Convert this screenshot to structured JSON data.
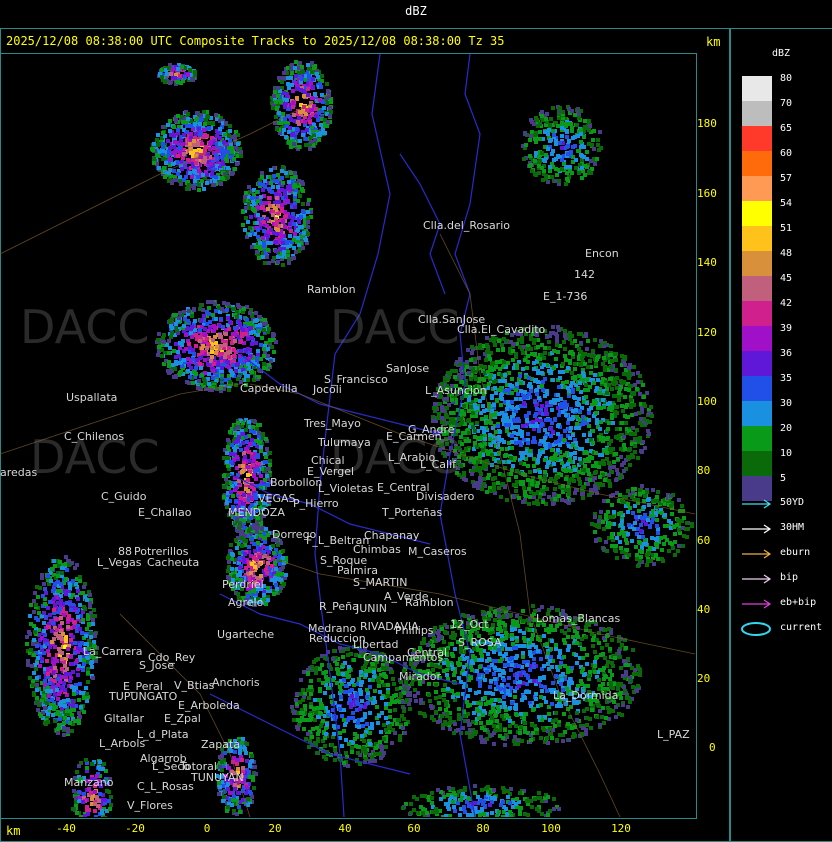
{
  "window_title": "dBZ",
  "header": {
    "text": "2025/12/08 08:38:00 UTC Composite Tracks to 2025/12/08 08:38:00 Tz 35",
    "km_unit": "km"
  },
  "axes": {
    "x_ticks": [
      "-40",
      "-20",
      "0",
      "20",
      "40",
      "60",
      "80",
      "100",
      "120"
    ],
    "y_ticks": [
      "180",
      "160",
      "140",
      "120",
      "100",
      "80",
      "60",
      "40",
      "20",
      "0"
    ],
    "x_unit": "km"
  },
  "legend": {
    "title": "dBZ",
    "levels": [
      {
        "label": "80",
        "color": "#e8e8e8"
      },
      {
        "label": "70",
        "color": "#bdbdbd"
      },
      {
        "label": "65",
        "color": "#ff3a2a"
      },
      {
        "label": "60",
        "color": "#ff6a0a"
      },
      {
        "label": "57",
        "color": "#ff9a55"
      },
      {
        "label": "54",
        "color": "#ffff00"
      },
      {
        "label": "51",
        "color": "#ffc21a"
      },
      {
        "label": "48",
        "color": "#d8913a"
      },
      {
        "label": "45",
        "color": "#c0607c"
      },
      {
        "label": "42",
        "color": "#d0208e"
      },
      {
        "label": "39",
        "color": "#a010c8"
      },
      {
        "label": "36",
        "color": "#6018d8"
      },
      {
        "label": "35",
        "color": "#2050e8"
      },
      {
        "label": "30",
        "color": "#1a90e0"
      },
      {
        "label": "20",
        "color": "#0a9a1a"
      },
      {
        "label": "10",
        "color": "#0a6a0a"
      },
      {
        "label": "5",
        "color": "#4a3a8a"
      }
    ],
    "tracks": [
      {
        "label": "50YD",
        "color": "#40e0f0"
      },
      {
        "label": "30HM",
        "color": "#ffffff"
      },
      {
        "label": "eburn",
        "color": "#f0b040"
      },
      {
        "label": "bip",
        "color": "#f0d0f0"
      },
      {
        "label": "eb+bip",
        "color": "#e040e0"
      },
      {
        "label": "current",
        "color": "#30d8f0"
      }
    ]
  },
  "places": [
    {
      "name": "Clla.del_Rosario"
    },
    {
      "name": "Encon"
    },
    {
      "name": "142"
    },
    {
      "name": "E_1-736"
    },
    {
      "name": "Ramblon"
    },
    {
      "name": "Clla.SanJose"
    },
    {
      "name": "Clla.El_Cavadito"
    },
    {
      "name": "Uspallata"
    },
    {
      "name": "C_Chilenos"
    },
    {
      "name": "aredas"
    },
    {
      "name": "Capdevilla"
    },
    {
      "name": "S_Francisco"
    },
    {
      "name": "Jocoli"
    },
    {
      "name": "SanJose"
    },
    {
      "name": "L_Asuncion"
    },
    {
      "name": "Tres_Mayo"
    },
    {
      "name": "Tulumaya"
    },
    {
      "name": "E_Carmen"
    },
    {
      "name": "G_Andre"
    },
    {
      "name": "Chical"
    },
    {
      "name": "L_Arabio"
    },
    {
      "name": "E_Vergel"
    },
    {
      "name": "L_Calif"
    },
    {
      "name": "Borbollon"
    },
    {
      "name": "L_Violetas"
    },
    {
      "name": "E_Central"
    },
    {
      "name": "Divisadero"
    },
    {
      "name": "C_Guido"
    },
    {
      "name": "VEGAS"
    },
    {
      "name": "P_Hierro"
    },
    {
      "name": "E_Challao"
    },
    {
      "name": "MENDOZA"
    },
    {
      "name": "T_Porteñas"
    },
    {
      "name": "Dorrego"
    },
    {
      "name": "F_L_Beltran"
    },
    {
      "name": "Chapanay"
    },
    {
      "name": "Potrerillos"
    },
    {
      "name": "Cacheuta"
    },
    {
      "name": "Chimbas"
    },
    {
      "name": "M_Caseros"
    },
    {
      "name": "L_Vegas"
    },
    {
      "name": "S_Roque"
    },
    {
      "name": "Palmira"
    },
    {
      "name": "Perdriel"
    },
    {
      "name": "S_MARTIN"
    },
    {
      "name": "A_Verde"
    },
    {
      "name": "Agrelo"
    },
    {
      "name": "R_Peña"
    },
    {
      "name": "JUNIN"
    },
    {
      "name": "Ramblon"
    },
    {
      "name": "12_Oct"
    },
    {
      "name": "Ugarteche"
    },
    {
      "name": "Medrano"
    },
    {
      "name": "RIVADAVIA"
    },
    {
      "name": "Phillips"
    },
    {
      "name": "Reduccion"
    },
    {
      "name": "S_ROSA"
    },
    {
      "name": "Lomas_Blancas"
    },
    {
      "name": "La_Carrera"
    },
    {
      "name": "Cdo_Rey"
    },
    {
      "name": "Libertad"
    },
    {
      "name": "S_Jose"
    },
    {
      "name": "Campamentos"
    },
    {
      "name": "Central"
    },
    {
      "name": "Anchoris"
    },
    {
      "name": "E_Peral"
    },
    {
      "name": "V_Btias"
    },
    {
      "name": "TUPUNGATO"
    },
    {
      "name": "Mirador"
    },
    {
      "name": "La_Dormida"
    },
    {
      "name": "E_Arboleda"
    },
    {
      "name": "Gltallar"
    },
    {
      "name": "E_Zpal"
    },
    {
      "name": "L_d_Plata"
    },
    {
      "name": "L_Arbols"
    },
    {
      "name": "Zapata"
    },
    {
      "name": "Algarrob"
    },
    {
      "name": "L_Seco"
    },
    {
      "name": "Totoral"
    },
    {
      "name": "TUNUYAN"
    },
    {
      "name": "C_L_Rosas"
    },
    {
      "name": "Manzano"
    },
    {
      "name": "V_Flores"
    },
    {
      "name": "L_PAZ"
    },
    {
      "name": "88"
    }
  ]
}
